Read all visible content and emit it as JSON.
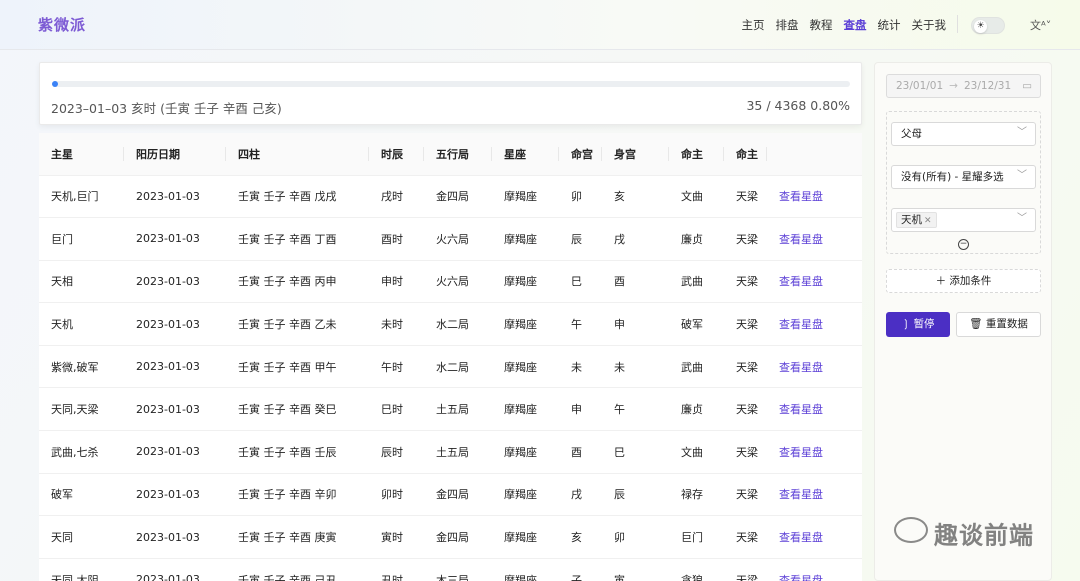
{
  "app": {
    "logo": "紫微派"
  },
  "nav": [
    {
      "label": "主页",
      "active": false
    },
    {
      "label": "排盘",
      "active": false
    },
    {
      "label": "教程",
      "active": false
    },
    {
      "label": "查盘",
      "active": true
    },
    {
      "label": "统计",
      "active": false
    },
    {
      "label": "关于我",
      "active": false
    }
  ],
  "header": {
    "theme_icon": "sun-icon",
    "lang_icon": "translate-icon",
    "lang_glyph": "文ᴬ˅"
  },
  "progress": {
    "fraction": 0.008,
    "label": "2023–01–03 亥时 (壬寅 壬子 辛酉 己亥)",
    "count": "35 / 4368 0.80%"
  },
  "table": {
    "columns": [
      "主星",
      "阳历日期",
      "四柱",
      "时辰",
      "五行局",
      "星座",
      "命宫",
      "身宫",
      "命主",
      "命主",
      ""
    ],
    "rows": [
      [
        "天机,巨门",
        "2023-01-03",
        "壬寅 壬子 辛酉 戊戌",
        "戌时",
        "金四局",
        "摩羯座",
        "卯",
        "亥",
        "文曲",
        "天梁",
        "查看星盘"
      ],
      [
        "巨门",
        "2023-01-03",
        "壬寅 壬子 辛酉 丁酉",
        "酉时",
        "火六局",
        "摩羯座",
        "辰",
        "戌",
        "廉贞",
        "天梁",
        "查看星盘"
      ],
      [
        "天相",
        "2023-01-03",
        "壬寅 壬子 辛酉 丙申",
        "申时",
        "火六局",
        "摩羯座",
        "巳",
        "酉",
        "武曲",
        "天梁",
        "查看星盘"
      ],
      [
        "天机",
        "2023-01-03",
        "壬寅 壬子 辛酉 乙未",
        "未时",
        "水二局",
        "摩羯座",
        "午",
        "申",
        "破军",
        "天梁",
        "查看星盘"
      ],
      [
        "紫微,破军",
        "2023-01-03",
        "壬寅 壬子 辛酉 甲午",
        "午时",
        "水二局",
        "摩羯座",
        "未",
        "未",
        "武曲",
        "天梁",
        "查看星盘"
      ],
      [
        "天同,天梁",
        "2023-01-03",
        "壬寅 壬子 辛酉 癸巳",
        "巳时",
        "土五局",
        "摩羯座",
        "申",
        "午",
        "廉贞",
        "天梁",
        "查看星盘"
      ],
      [
        "武曲,七杀",
        "2023-01-03",
        "壬寅 壬子 辛酉 壬辰",
        "辰时",
        "土五局",
        "摩羯座",
        "酉",
        "巳",
        "文曲",
        "天梁",
        "查看星盘"
      ],
      [
        "破军",
        "2023-01-03",
        "壬寅 壬子 辛酉 辛卯",
        "卯时",
        "金四局",
        "摩羯座",
        "戌",
        "辰",
        "禄存",
        "天梁",
        "查看星盘"
      ],
      [
        "天同",
        "2023-01-03",
        "壬寅 壬子 辛酉 庚寅",
        "寅时",
        "金四局",
        "摩羯座",
        "亥",
        "卯",
        "巨门",
        "天梁",
        "查看星盘"
      ],
      [
        "天同,太阴",
        "2023-01-03",
        "壬寅 壬子 辛酉 己丑",
        "丑时",
        "木三局",
        "摩羯座",
        "子",
        "寅",
        "贪狼",
        "天梁",
        "查看星盘"
      ]
    ]
  },
  "panel": {
    "date_start": "23/01/01",
    "date_arrow": "→",
    "date_end": "23/12/31",
    "select_palace": "父母",
    "select_stars": "没有(所有) - 星耀多选",
    "tag_star": "天机",
    "add_condition": "添加条件",
    "pause": "暂停",
    "reset": "重置数据"
  },
  "watermark": "趣谈前端",
  "colors": {
    "accent": "#5b3fd6",
    "button": "#4b2fc4",
    "progress": "#3b82f6",
    "logo": "#7d5bd4"
  }
}
